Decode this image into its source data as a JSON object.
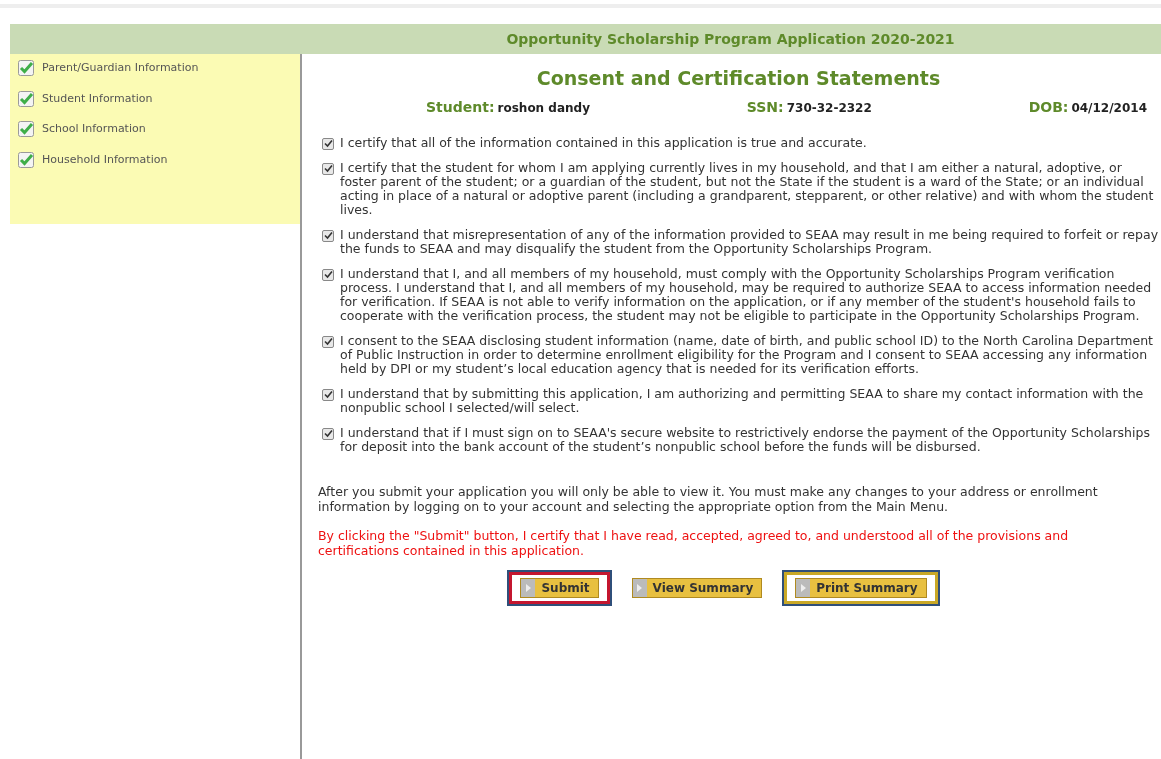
{
  "header": {
    "title": "Opportunity Scholarship Program Application 2020-2021"
  },
  "sidebar": {
    "items": [
      {
        "label": "Parent/Guardian Information",
        "checked": true
      },
      {
        "label": "Student Information",
        "checked": true
      },
      {
        "label": "School Information",
        "checked": true
      },
      {
        "label": "Household Information",
        "checked": true
      }
    ]
  },
  "main": {
    "title": "Consent and Certification Statements",
    "info": [
      {
        "label": "Student:",
        "value": "roshon dandy"
      },
      {
        "label": "SSN:",
        "value": "730-32-2322"
      },
      {
        "label": "DOB:",
        "value": "04/12/2014"
      }
    ],
    "statements": [
      {
        "text": "I certify that all of the information contained in this application is true and accurate.",
        "checked": true
      },
      {
        "text": "I certify that the student for whom I am applying currently lives in my household, and that I am either a natural, adoptive, or foster parent of the student; or a guardian of the student, but not the State if the student is a ward of the State; or an individual acting in place of a natural or adoptive parent (including a grandparent, stepparent, or other relative) and with whom the student lives.",
        "checked": true
      },
      {
        "text": "I understand that misrepresentation of any of the information provided to SEAA may result in me being required to forfeit or repay the funds to SEAA and may disqualify the student from the Opportunity Scholarships Program.",
        "checked": true
      },
      {
        "text": "I understand that I, and all members of my household, must comply with the Opportunity Scholarships Program verification process. I understand that I, and all members of my household, may be required to authorize SEAA to access information needed for verification. If SEAA is not able to verify information on the application, or if any member of the student's household fails to cooperate with the verification process, the student may not be eligible to participate in the Opportunity Scholarships Program.",
        "checked": true
      },
      {
        "text": "I consent to the SEAA disclosing student information (name, date of birth, and public school ID) to the North Carolina Department of Public Instruction in order to determine enrollment eligibility for the Program and I consent to SEAA accessing any information held by DPI or my student’s local education agency that is needed for its verification efforts.",
        "checked": true
      },
      {
        "text": "I understand that by submitting this application, I am authorizing and permitting SEAA to share my contact information with the nonpublic school I selected/will select.",
        "checked": true
      },
      {
        "text": "I understand that if I must sign on to SEAA's secure website to restrictively endorse the payment of the Opportunity Scholarships for deposit into the bank account of the student’s nonpublic school before the funds will be disbursed.",
        "checked": true
      }
    ],
    "note": "After you submit your application you will only be able to view it. You must make any changes to your address or enrollment information by logging on to your account and selecting the appropriate option from the Main Menu.",
    "warning": "By clicking the \"Submit\" button, I certify that I have read, accepted, agreed to, and understood all of the provisions and certifications contained in this application.",
    "buttons": [
      {
        "label": "Submit",
        "highlighted": true,
        "color": "#c4162f"
      },
      {
        "label": "View Summary",
        "highlighted": false
      },
      {
        "label": "Print Summary",
        "highlighted": true,
        "color": "#c9a826"
      }
    ]
  }
}
